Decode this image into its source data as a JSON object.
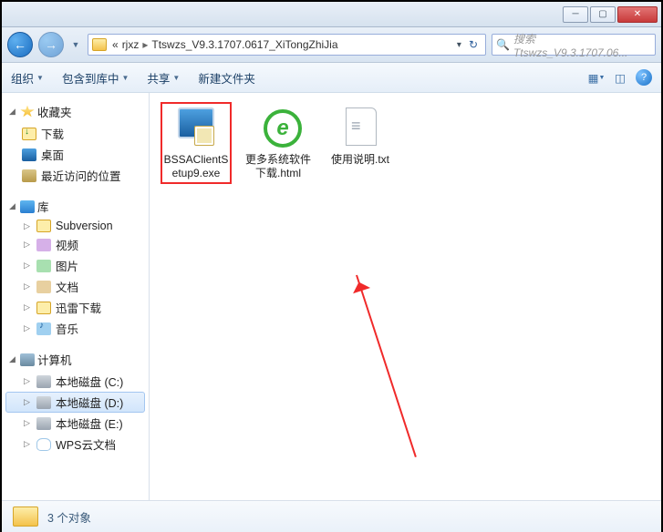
{
  "breadcrumb": {
    "back": "«",
    "part1": "rjxz",
    "part2": "Ttswzs_V9.3.1707.0617_XiTongZhiJia"
  },
  "search": {
    "placeholder": "搜索 Ttswzs_V9.3.1707.06..."
  },
  "toolbar": {
    "organize": "组织",
    "include": "包含到库中",
    "share": "共享",
    "newfolder": "新建文件夹"
  },
  "sidebar": {
    "favorites": {
      "label": "收藏夹",
      "items": [
        "下载",
        "桌面",
        "最近访问的位置"
      ]
    },
    "libraries": {
      "label": "库",
      "items": [
        "Subversion",
        "视频",
        "图片",
        "文档",
        "迅雷下载",
        "音乐"
      ]
    },
    "computer": {
      "label": "计算机",
      "items": [
        "本地磁盘 (C:)",
        "本地磁盘 (D:)",
        "本地磁盘 (E:)",
        "WPS云文档"
      ]
    }
  },
  "files": [
    {
      "name": "BSSAClientSetup9.exe",
      "type": "exe",
      "highlight": true
    },
    {
      "name": "更多系统软件下载.html",
      "type": "html",
      "highlight": false
    },
    {
      "name": "使用说明.txt",
      "type": "txt",
      "highlight": false
    }
  ],
  "status": {
    "text": "3 个对象"
  }
}
